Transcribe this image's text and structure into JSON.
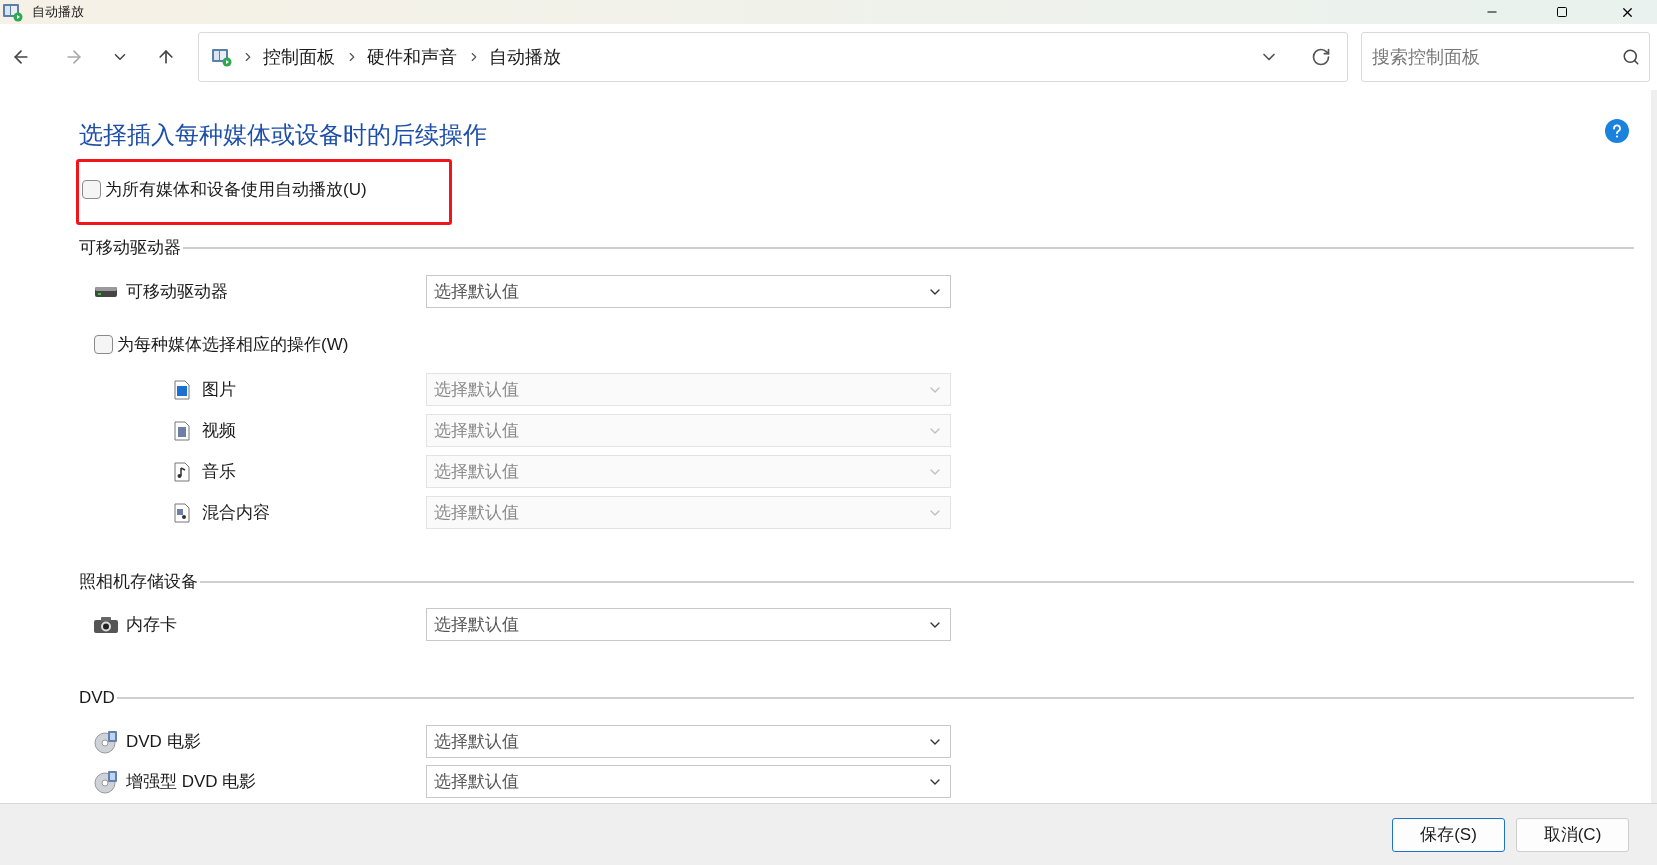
{
  "window": {
    "title": "自动播放"
  },
  "address": {
    "breadcrumbs": [
      "控制面板",
      "硬件和声音",
      "自动播放"
    ]
  },
  "search": {
    "placeholder": "搜索控制面板"
  },
  "heading": "选择插入每种媒体或设备时的后续操作",
  "autoplay_all": {
    "label": "为所有媒体和设备使用自动播放(U)",
    "checked": false,
    "highlighted": true
  },
  "sections": [
    {
      "title": "可移动驱动器",
      "items": [
        {
          "kind": "drive",
          "label": "可移动驱动器",
          "value": "选择默认值",
          "disabled": false
        },
        {
          "kind": "checkbox",
          "label": "为每种媒体选择相应的操作(W)",
          "checked": false,
          "children": [
            {
              "kind": "picture",
              "label": "图片",
              "value": "选择默认值",
              "disabled": true
            },
            {
              "kind": "video",
              "label": "视频",
              "value": "选择默认值",
              "disabled": true
            },
            {
              "kind": "music",
              "label": "音乐",
              "value": "选择默认值",
              "disabled": true
            },
            {
              "kind": "mixed",
              "label": "混合内容",
              "value": "选择默认值",
              "disabled": true
            }
          ]
        }
      ]
    },
    {
      "title": "照相机存储设备",
      "items": [
        {
          "kind": "camera",
          "label": "内存卡",
          "value": "选择默认值",
          "disabled": false
        }
      ]
    },
    {
      "title": "DVD",
      "items": [
        {
          "kind": "disc",
          "label": "DVD 电影",
          "value": "选择默认值",
          "disabled": false
        },
        {
          "kind": "disc",
          "label": "增强型 DVD 电影",
          "value": "选择默认值",
          "disabled": false
        }
      ]
    }
  ],
  "buttons": [
    {
      "label": "保存(S)",
      "default": true
    },
    {
      "label": "取消(C)",
      "default": false
    }
  ]
}
